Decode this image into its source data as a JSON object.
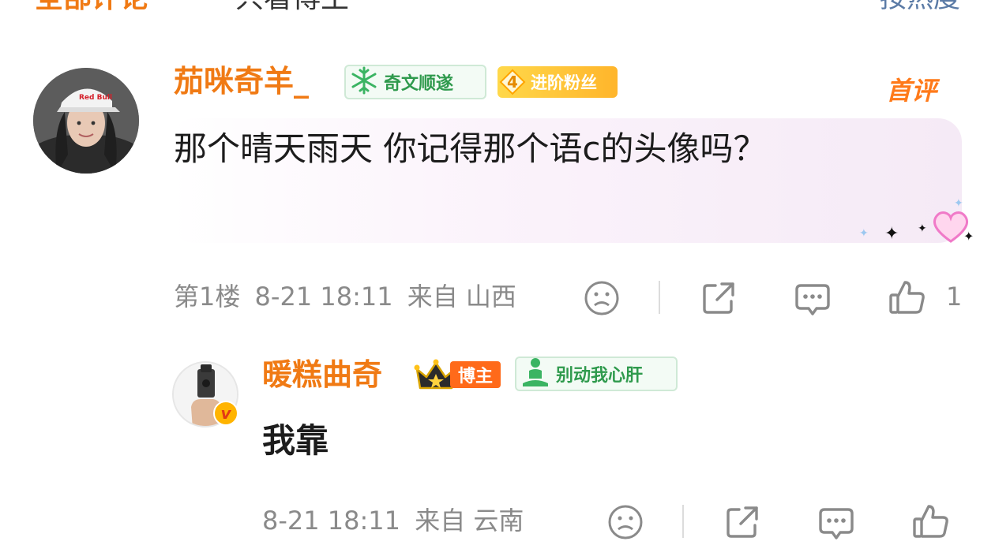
{
  "top_tabs": {
    "all": "全部评论",
    "hot": "只看博主",
    "sort": "按热度"
  },
  "comment": {
    "username": "茄咪奇羊_",
    "badge_wenshun": "奇文顺遂",
    "fan_level": "4",
    "fan_label": "进阶粉丝",
    "first_label": "首评",
    "text": "那个晴天雨天 你记得那个语c的头像吗？",
    "floor": "第1楼",
    "time": "8-21 18:11",
    "location": "来自 山西",
    "like_count": "1"
  },
  "reply": {
    "username": "暖糕曲奇",
    "host_label": "博主",
    "badge_heart": "别动我心肝",
    "text": "我靠",
    "time": "8-21 18:11",
    "location": "来自 云南"
  },
  "colors": {
    "accent": "#f07a14",
    "meta": "#8a8a8a",
    "green_badge": "#2f9a4d"
  }
}
